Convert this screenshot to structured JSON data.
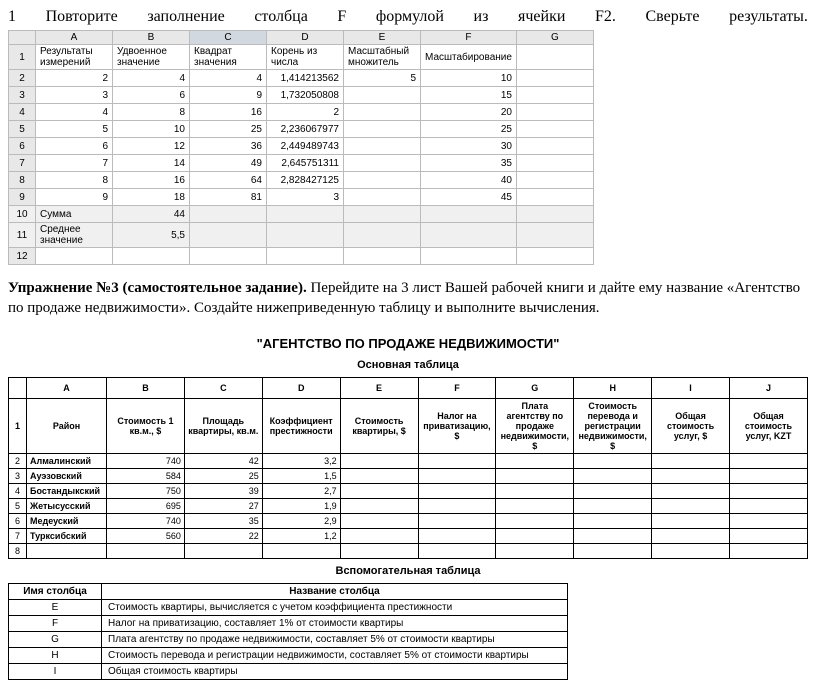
{
  "top_instruction": {
    "words": [
      "Повторите",
      "заполнение",
      "столбца",
      "F",
      "формулой",
      "из",
      "ячейки",
      "F2.",
      "Сверьте",
      "результаты."
    ],
    "leading": "1"
  },
  "ss": {
    "cols": [
      "A",
      "B",
      "C",
      "D",
      "E",
      "F",
      "G"
    ],
    "headers": [
      "Результаты измерений",
      "Удвоенное значение",
      "Квадрат значения",
      "Корень из числа",
      "Масштабный множитель",
      "Масштабирование",
      ""
    ],
    "rows": [
      [
        "2",
        "4",
        "4",
        "1,414213562",
        "5",
        "10",
        ""
      ],
      [
        "3",
        "6",
        "9",
        "1,732050808",
        "",
        "15",
        ""
      ],
      [
        "4",
        "8",
        "16",
        "2",
        "",
        "20",
        ""
      ],
      [
        "5",
        "10",
        "25",
        "2,236067977",
        "",
        "25",
        ""
      ],
      [
        "6",
        "12",
        "36",
        "2,449489743",
        "",
        "30",
        ""
      ],
      [
        "7",
        "14",
        "49",
        "2,645751311",
        "",
        "35",
        ""
      ],
      [
        "8",
        "16",
        "64",
        "2,828427125",
        "",
        "40",
        ""
      ],
      [
        "9",
        "18",
        "81",
        "3",
        "",
        "45",
        ""
      ]
    ],
    "sum_label": "Сумма",
    "sum_val": "44",
    "avg_label": "Среднее значение",
    "avg_val": "5,5"
  },
  "exercise": {
    "prefix": "Упражнение №3 (самостоятельное задание).",
    "text": "  Перейдите на 3 лист Вашей рабочей книги и дайте ему название «Агентство по продаже недвижимости». Создайте нижеприведенную таблицу и выполните вычисления."
  },
  "agency_title": "\"АГЕНТСТВО ПО ПРОДАЖЕ НЕДВИЖИМОСТИ\"",
  "main_subtitle": "Основная таблица",
  "main": {
    "letters": [
      "",
      "A",
      "B",
      "C",
      "D",
      "E",
      "F",
      "G",
      "H",
      "I",
      "J"
    ],
    "head2": [
      "1",
      "Район",
      "Стоимость 1 кв.м., $",
      "Площадь квартиры, кв.м.",
      "Коэффициент престижности",
      "Стоимость квартиры, $",
      "Налог на приватизацию, $",
      "Плата агентству по продаже недвижимости, $",
      "Стоимость перевода и регистрации недвижимости, $",
      "Общая стоимость услуг, $",
      "Общая стоимость услуг, KZT"
    ],
    "rows": [
      [
        "2",
        "Алмалинский",
        "740",
        "42",
        "3,2",
        "",
        "",
        "",
        "",
        "",
        ""
      ],
      [
        "3",
        "Ауэзовский",
        "584",
        "25",
        "1,5",
        "",
        "",
        "",
        "",
        "",
        ""
      ],
      [
        "4",
        "Бостандыкский",
        "750",
        "39",
        "2,7",
        "",
        "",
        "",
        "",
        "",
        ""
      ],
      [
        "5",
        "Жетысусский",
        "695",
        "27",
        "1,9",
        "",
        "",
        "",
        "",
        "",
        ""
      ],
      [
        "6",
        "Медеуский",
        "740",
        "35",
        "2,9",
        "",
        "",
        "",
        "",
        "",
        ""
      ],
      [
        "7",
        "Турксибский",
        "560",
        "22",
        "1,2",
        "",
        "",
        "",
        "",
        "",
        ""
      ],
      [
        "8",
        "",
        "",
        "",
        "",
        "",
        "",
        "",
        "",
        "",
        ""
      ]
    ]
  },
  "aux_subtitle": "Вспомогательная таблица",
  "aux": {
    "headers": [
      "Имя столбца",
      "Название столбца"
    ],
    "rows": [
      [
        "E",
        "Стоимость квартиры, вычисляется с учетом коэффициента престижности"
      ],
      [
        "F",
        "Налог на приватизацию, составляет 1% от стоимости квартиры"
      ],
      [
        "G",
        "Плата агентству по продаже недвижимости, составляет 5% от стоимости квартиры"
      ],
      [
        "H",
        "Стоимость перевода и регистрации недвижимости, составляет 5% от стоимости квартиры"
      ],
      [
        "I",
        "Общая стоимость квартиры"
      ]
    ]
  }
}
